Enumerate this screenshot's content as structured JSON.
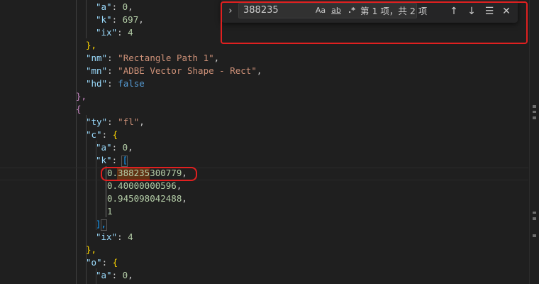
{
  "find": {
    "query": "388235",
    "opt_case": "Aa",
    "opt_word": "ab",
    "opt_regex": ".*",
    "match_count": "第 1 项，共 2 项",
    "toggle_icon": "›",
    "prev_icon": "↑",
    "next_icon": "↓",
    "selection_icon": "☰",
    "close_icon": "✕"
  },
  "code": {
    "l1": {
      "key": "\"a\"",
      "val": "0"
    },
    "l2": {
      "key": "\"k\"",
      "val": "697"
    },
    "l3": {
      "key": "\"ix\"",
      "val": "4"
    },
    "l4": {
      "text": "},"
    },
    "l5": {
      "key": "\"nm\"",
      "val": "\"Rectangle Path 1\""
    },
    "l6": {
      "key": "\"mn\"",
      "val": "\"ADBE Vector Shape - Rect\""
    },
    "l7": {
      "key": "\"hd\"",
      "val": "false"
    },
    "l8": {
      "text": "},"
    },
    "l9": {
      "text": "{"
    },
    "l10": {
      "key": "\"ty\"",
      "val": "\"fl\""
    },
    "l11": {
      "key": "\"c\"",
      "val": "{"
    },
    "l12": {
      "key": "\"a\"",
      "val": "0"
    },
    "l13": {
      "key": "\"k\"",
      "val": "["
    },
    "l14": {
      "val": "0.388235300779"
    },
    "l15": {
      "val": "0.40000000596"
    },
    "l16": {
      "val": "0.945098042488"
    },
    "l17": {
      "val": "1"
    },
    "l18": {
      "text": "],"
    },
    "l19": {
      "key": "\"ix\"",
      "val": "4"
    },
    "l20": {
      "text": "},"
    },
    "l21": {
      "key": "\"o\"",
      "val": "{"
    },
    "l22": {
      "key": "\"a\"",
      "val": "0"
    }
  },
  "colors": {
    "key": "#9cdcfe",
    "string": "#ce9178",
    "number": "#b5cea8",
    "keyword": "#569cd6",
    "annotation": "#e02020"
  }
}
